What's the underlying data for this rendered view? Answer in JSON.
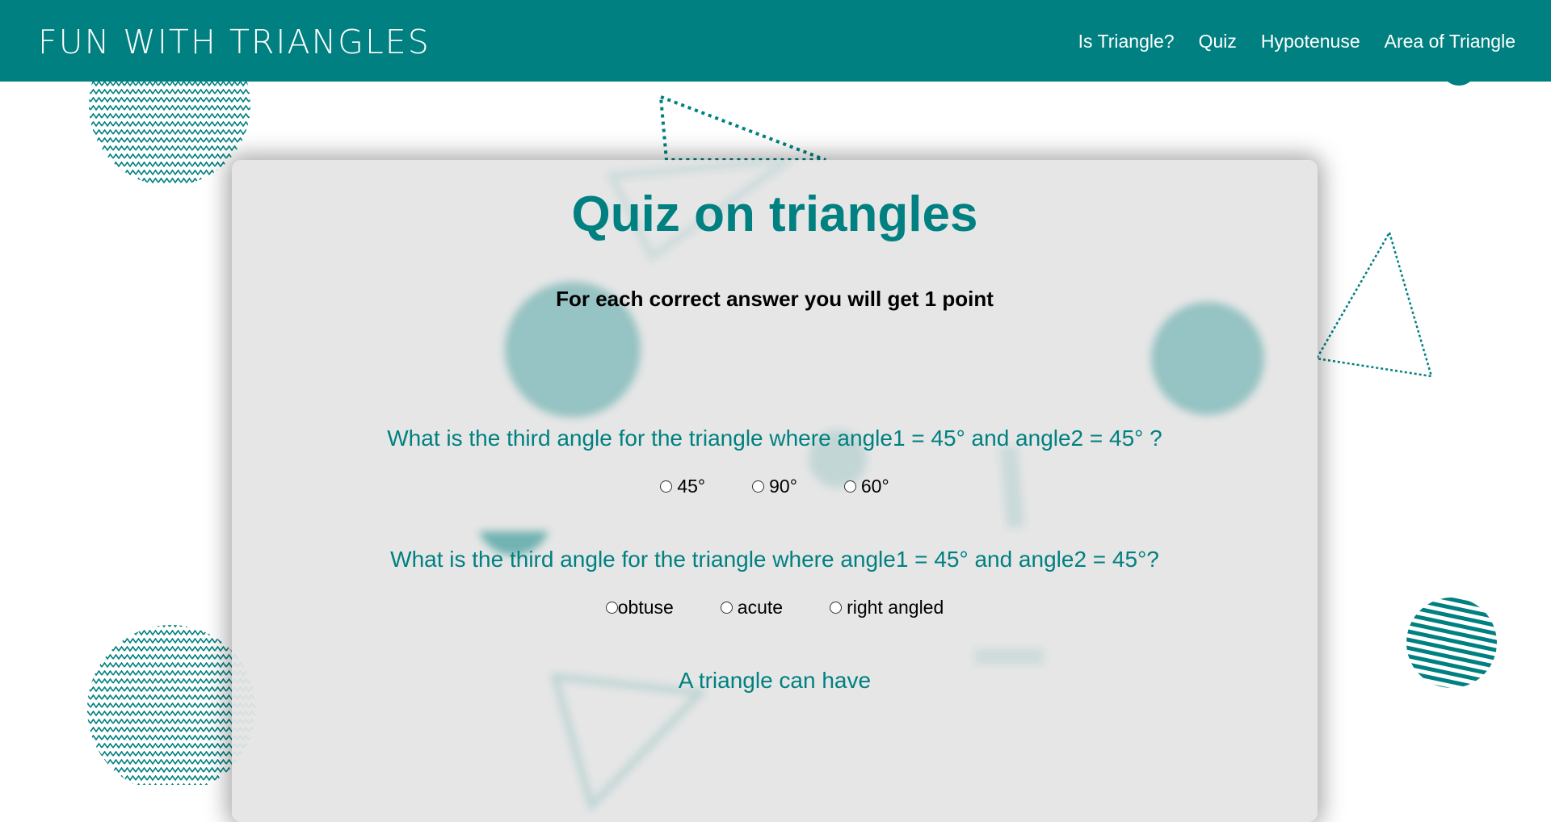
{
  "header": {
    "logo": "FUN WITH TRIANGLES",
    "nav": [
      {
        "label": "Is Triangle?"
      },
      {
        "label": "Quiz"
      },
      {
        "label": "Hypotenuse"
      },
      {
        "label": "Area of Triangle"
      }
    ]
  },
  "quiz": {
    "title": "Quiz on triangles",
    "subtitle": "For each correct answer you will get 1 point",
    "questions": [
      {
        "text": "What is the third angle for the triangle where angle1 = 45° and angle2 = 45° ?",
        "options": [
          "45°",
          "90°",
          "60°"
        ]
      },
      {
        "text": "What is the third angle for the triangle where angle1 = 45° and angle2 = 45°?",
        "options": [
          "obtuse",
          "acute",
          "right angled"
        ]
      },
      {
        "text": "A triangle can have"
      }
    ]
  },
  "colors": {
    "brand": "#008080",
    "card_background": "#e4e4e4",
    "text": "#000000"
  }
}
